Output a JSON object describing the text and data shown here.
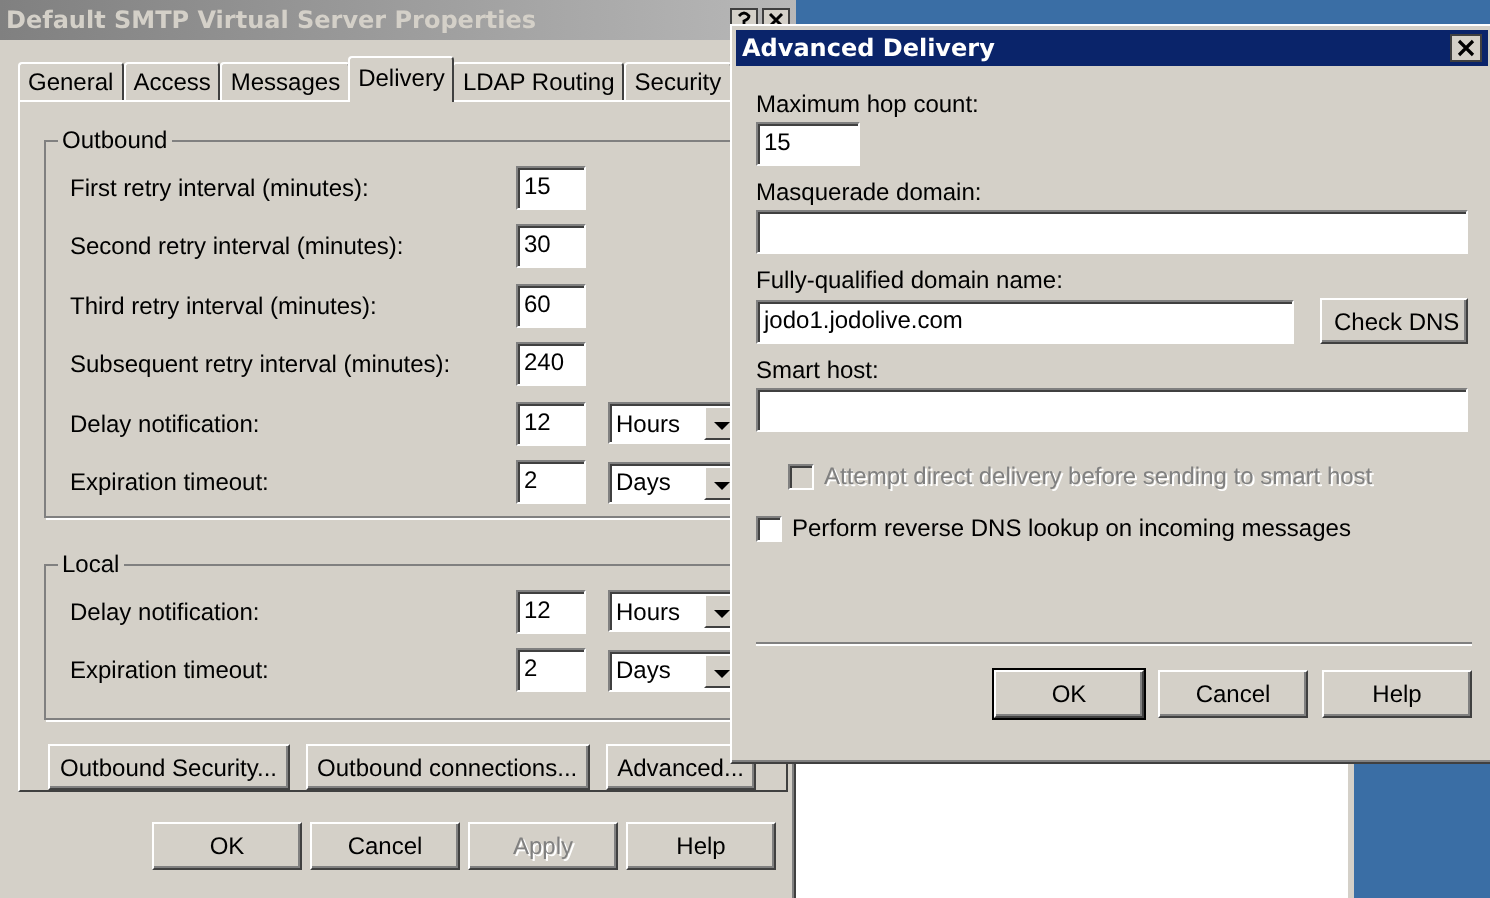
{
  "back_dialog": {
    "title": "Default SMTP Virtual Server Properties",
    "tabs": [
      {
        "label": "General",
        "selected": false
      },
      {
        "label": "Access",
        "selected": false
      },
      {
        "label": "Messages",
        "selected": false
      },
      {
        "label": "Delivery",
        "selected": true
      },
      {
        "label": "LDAP Routing",
        "selected": false
      },
      {
        "label": "Security",
        "selected": false
      }
    ],
    "groups": [
      {
        "label": "Outbound",
        "rows": [
          {
            "label": "First retry interval (minutes):",
            "value": "15"
          },
          {
            "label": "Second retry interval (minutes):",
            "value": "30"
          },
          {
            "label": "Third retry interval (minutes):",
            "value": "60"
          },
          {
            "label": "Subsequent retry interval (minutes):",
            "value": "240"
          },
          {
            "label": "Delay notification:",
            "value": "12",
            "unit": "Hours"
          },
          {
            "label": "Expiration timeout:",
            "value": "2",
            "unit": "Days"
          }
        ]
      },
      {
        "label": "Local",
        "rows": [
          {
            "label": "Delay notification:",
            "value": "12",
            "unit": "Hours"
          },
          {
            "label": "Expiration timeout:",
            "value": "2",
            "unit": "Days"
          }
        ]
      }
    ],
    "action_buttons": [
      "Outbound Security...",
      "Outbound connections...",
      "Advanced..."
    ],
    "buttons": [
      {
        "label": "OK",
        "disabled": false
      },
      {
        "label": "Cancel",
        "disabled": false
      },
      {
        "label": "Apply",
        "disabled": true
      },
      {
        "label": "Help",
        "disabled": false
      }
    ]
  },
  "front_dialog": {
    "title": "Advanced Delivery",
    "fields": [
      {
        "kind": "short",
        "label": "Maximum hop count:",
        "value": "15"
      },
      {
        "kind": "wide",
        "label": "Masquerade domain:"
      },
      {
        "kind": "with-button",
        "label": "Fully-qualified domain name:",
        "value": "jodo1.jodolive.com",
        "button": "Check DNS"
      },
      {
        "kind": "wide",
        "label": "Smart host:"
      }
    ],
    "checkboxes": [
      {
        "label": "Attempt direct delivery before sending to smart host",
        "checked": false,
        "disabled": true
      },
      {
        "label": "Perform reverse DNS lookup on incoming messages",
        "checked": false,
        "disabled": false
      }
    ],
    "buttons": [
      {
        "label": "OK",
        "default": true
      },
      {
        "label": "Cancel",
        "default": false
      },
      {
        "label": "Help",
        "default": false
      }
    ]
  }
}
